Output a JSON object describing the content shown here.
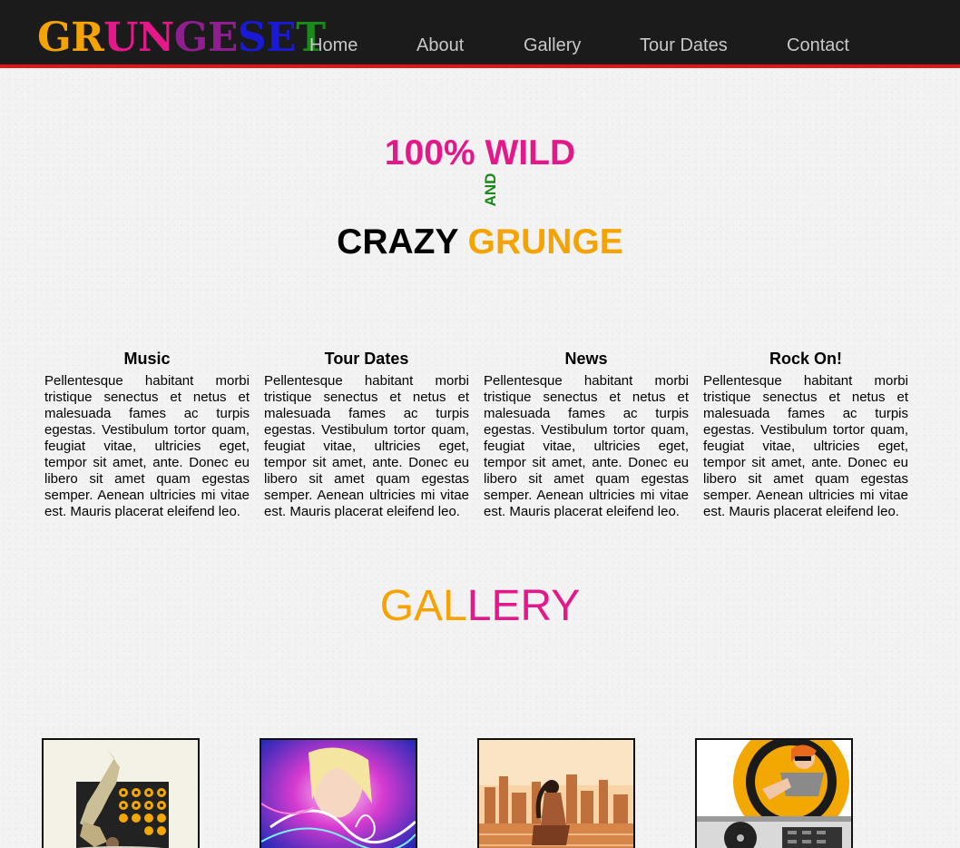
{
  "logo": {
    "letters": [
      {
        "char": "G",
        "color": "#f5a300"
      },
      {
        "char": "R",
        "color": "#f5a300"
      },
      {
        "char": "U",
        "color": "#e3198a"
      },
      {
        "char": "N",
        "color": "#e3198a"
      },
      {
        "char": "G",
        "color": "#8e1f8e"
      },
      {
        "char": "E",
        "color": "#8e1f8e"
      },
      {
        "char": "S",
        "color": "#1a1ad6"
      },
      {
        "char": "E",
        "color": "#1a1ad6"
      },
      {
        "char": "T",
        "color": "#1a8a1a"
      }
    ]
  },
  "nav": {
    "items": [
      {
        "label": "Home"
      },
      {
        "label": "About"
      },
      {
        "label": "Gallery"
      },
      {
        "label": "Tour Dates"
      },
      {
        "label": "Contact"
      }
    ]
  },
  "hero": {
    "line1": "100% WILD",
    "and": "AND",
    "line2_a": "CRAZY",
    "line2_b": "GRUNGE"
  },
  "features": [
    {
      "title": "Music",
      "text": "Pellentesque habitant morbi tristique senectus et netus et malesuada fames ac turpis egestas. Vestibulum tortor quam, feugiat vitae, ultricies eget, tempor sit amet, ante. Donec eu libero sit amet quam egestas semper. Aenean ultricies mi vitae est. Mauris placerat eleifend leo."
    },
    {
      "title": "Tour Dates",
      "text": "Pellentesque habitant morbi tristique senectus et netus et malesuada fames ac turpis egestas. Vestibulum tortor quam, feugiat vitae, ultricies eget, tempor sit amet, ante. Donec eu libero sit amet quam egestas semper. Aenean ultricies mi vitae est. Mauris placerat eleifend leo."
    },
    {
      "title": "News",
      "text": "Pellentesque habitant morbi tristique senectus et netus et malesuada fames ac turpis egestas. Vestibulum tortor quam, feugiat vitae, ultricies eget, tempor sit amet, ante. Donec eu libero sit amet quam egestas semper. Aenean ultricies mi vitae est. Mauris placerat eleifend leo."
    },
    {
      "title": "Rock On!",
      "text": "Pellentesque habitant morbi tristique senectus et netus et malesuada fames ac turpis egestas. Vestibulum tortor quam, feugiat vitae, ultricies eget, tempor sit amet, ante. Donec eu libero sit amet quam egestas semper. Aenean ultricies mi vitae est. Mauris placerat eleifend leo."
    }
  ],
  "gallery": {
    "title_a": "GAL",
    "title_b": "LERY"
  },
  "colors": {
    "pink": "#e3198a",
    "orange": "#f5a300",
    "green": "#1a8a1a",
    "header_bg": "#1b1b1b",
    "header_border": "#e0151b",
    "nav_text": "#c8c8c8"
  }
}
